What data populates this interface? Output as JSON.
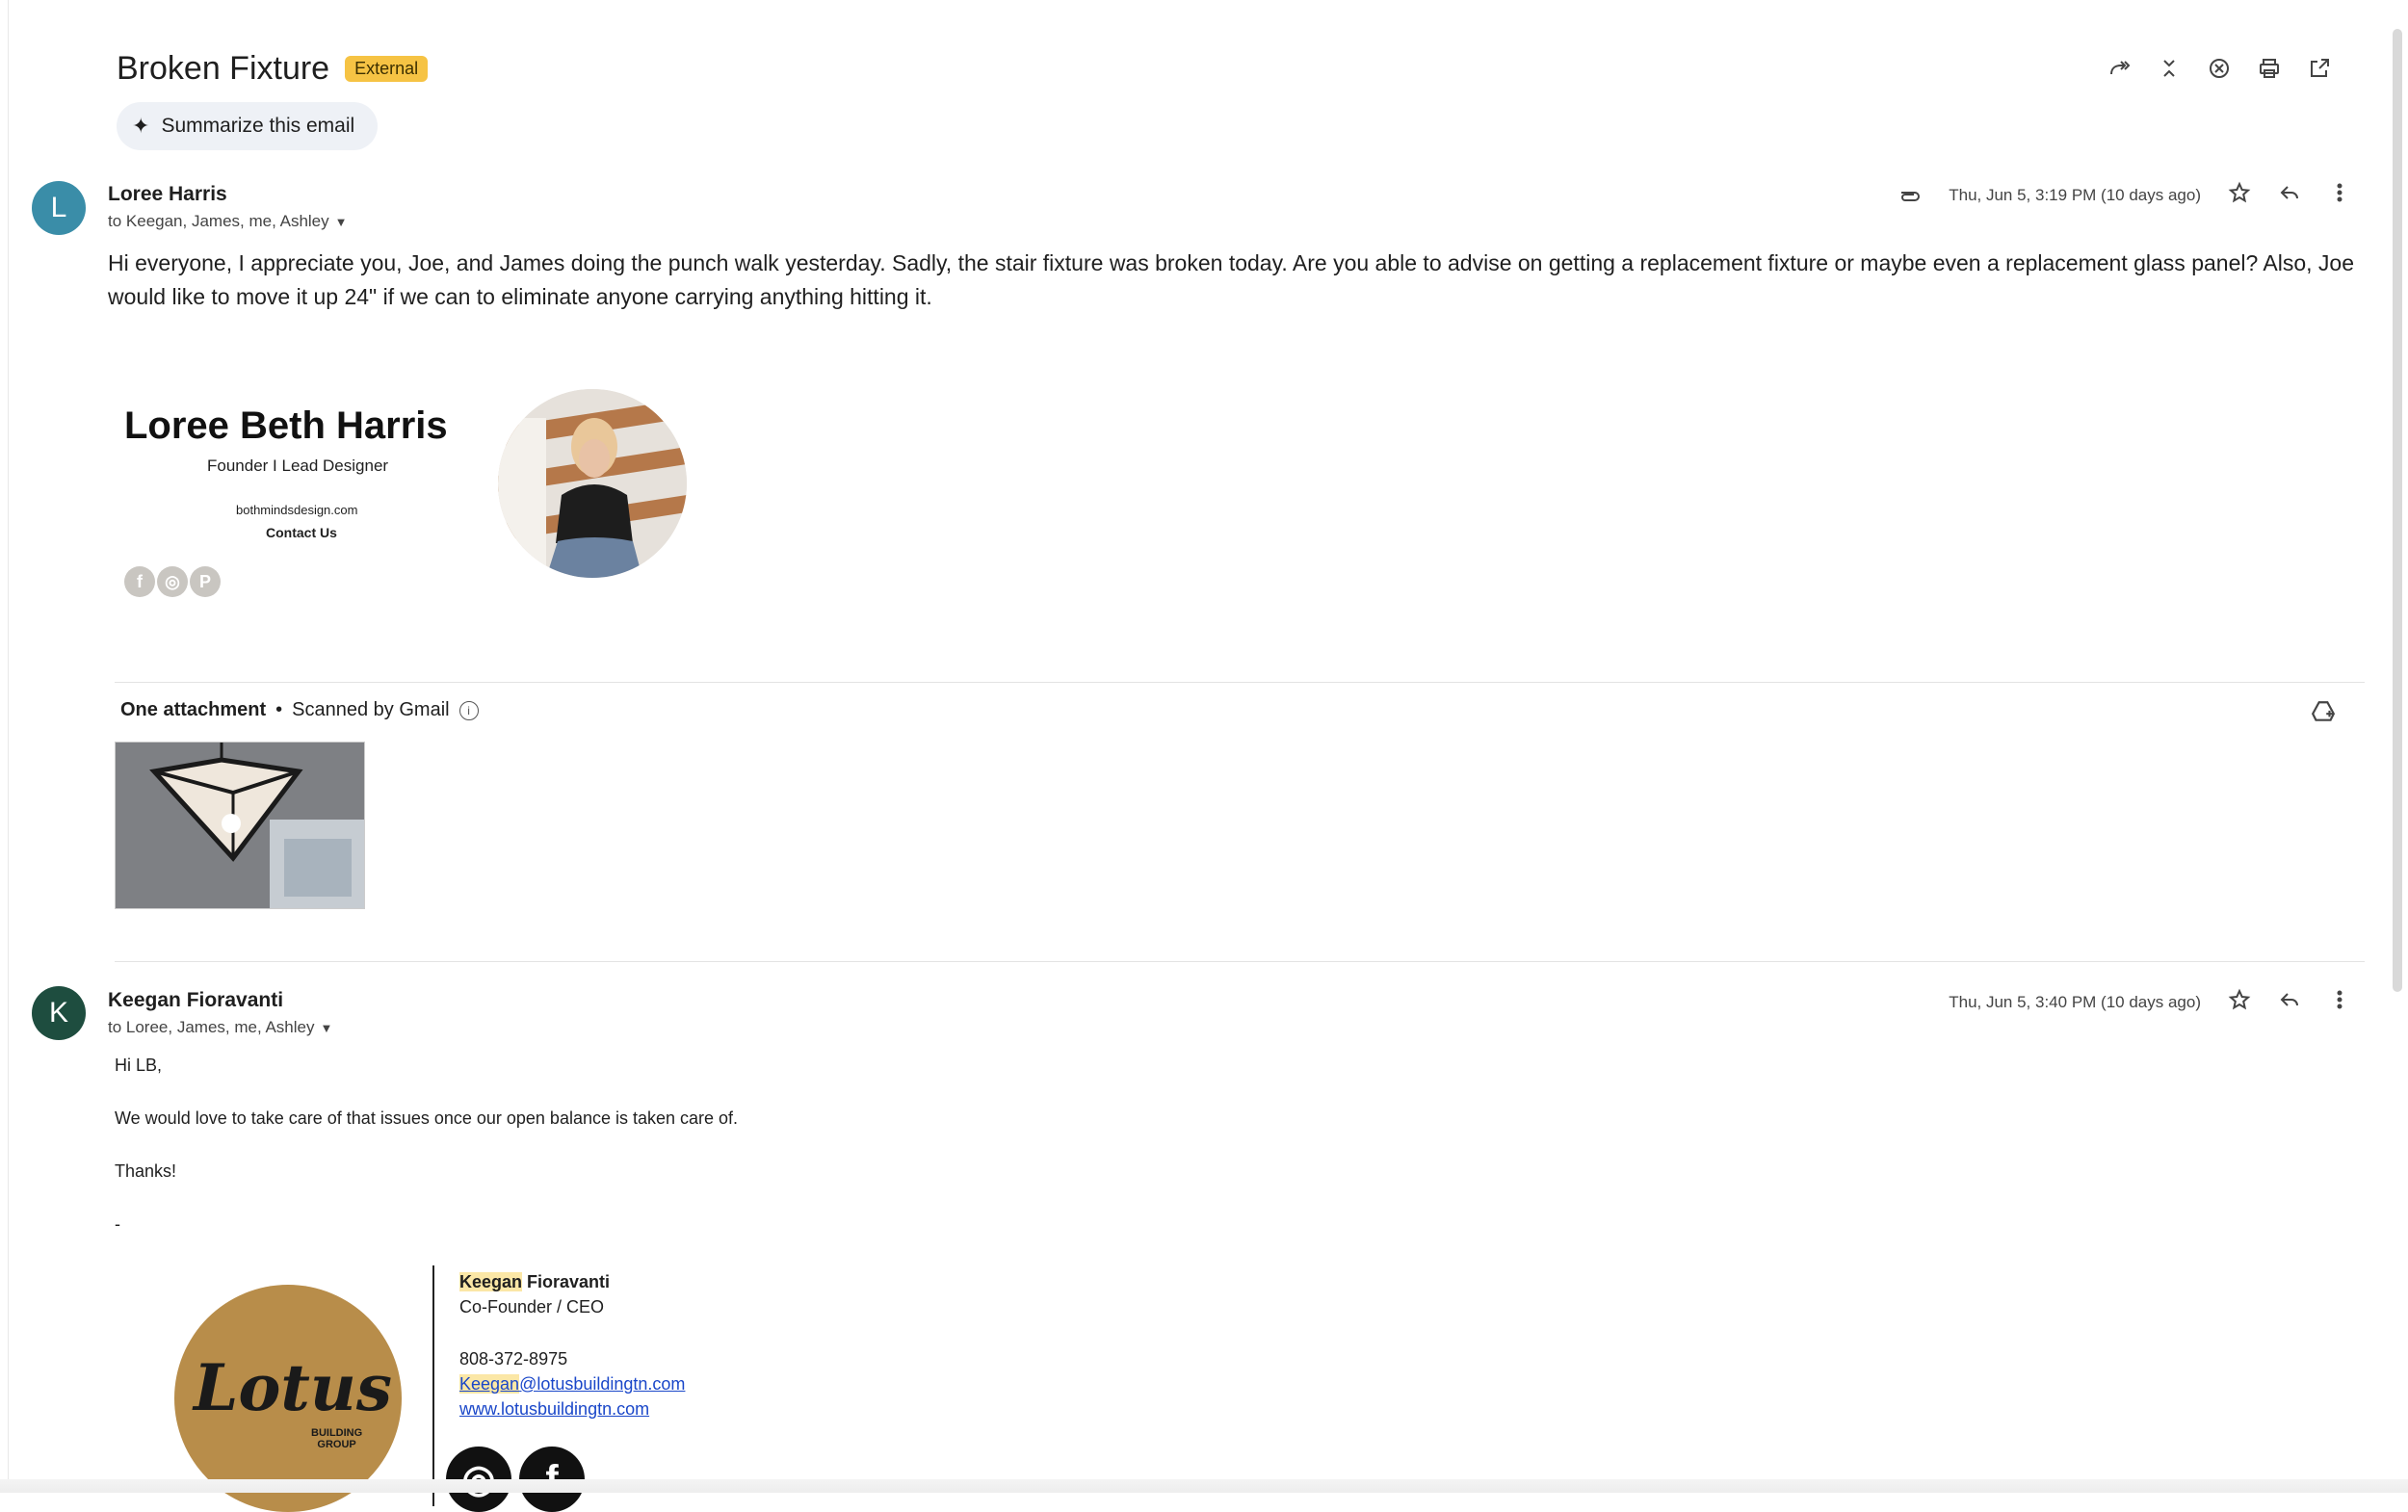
{
  "thread": {
    "subject": "Broken Fixture",
    "badge": "External",
    "summarize_label": "Summarize this email"
  },
  "messages": [
    {
      "avatar_letter": "L",
      "avatar_color": "#3a8da8",
      "sender": "Loree Harris",
      "recipients": "to Keegan, James, me, Ashley",
      "date": "Thu, Jun 5, 3:19 PM (10 days ago)",
      "body": "Hi everyone, I appreciate you, Joe, and James doing the punch walk yesterday. Sadly, the stair fixture was broken today. Are you able to advise on getting a replacement fixture or maybe even a replacement glass panel? Also, Joe would like to move it up 24\" if we can to eliminate anyone carrying anything hitting it.",
      "signature": {
        "name": "Loree Beth Harris",
        "role": "Founder I Lead Designer",
        "website": "bothmindsdesign.com",
        "contact": "Contact Us"
      },
      "attachments": {
        "title": "One attachment",
        "scanned": "Scanned by Gmail"
      }
    },
    {
      "avatar_letter": "K",
      "avatar_color": "#1e4d3f",
      "sender": "Keegan Fioravanti",
      "recipients": "to Loree, James, me, Ashley",
      "date": "Thu, Jun 5, 3:40 PM (10 days ago)",
      "greeting": "Hi LB,",
      "line1": "We would love to take care of that issues once our open balance is taken care of.",
      "thanks": "Thanks!",
      "dash": "-",
      "signature": {
        "logo_word": "Lotus",
        "logo_sub1": "BUILDING",
        "logo_sub2": "GROUP",
        "first": "Keegan",
        "last": " Fioravanti",
        "title": "Co-Founder / CEO",
        "phone": "808-372-8975",
        "email_user": "Keegan",
        "email_domain": "@lotusbuildingtn.com",
        "website": "www.lotusbuildingtn.com"
      }
    }
  ]
}
